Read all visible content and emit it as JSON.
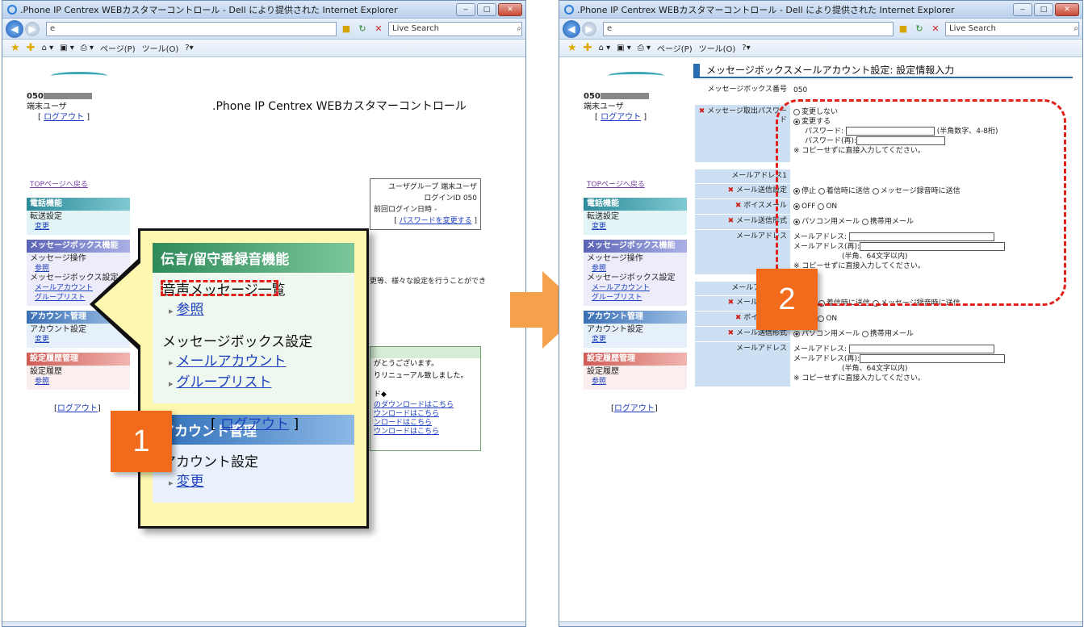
{
  "window_title": ".Phone IP Centrex WEBカスタマーコントロール - Dell により提供された Internet Explorer",
  "address_value": "e",
  "search_placeholder": "Live Search",
  "toolbar": {
    "page": "ページ(P)",
    "tools": "ツール(O)"
  },
  "left": {
    "user_id": "050",
    "user_role": "端末ユーザ",
    "logout": "ログアウト",
    "page_title": ".Phone IP Centrex WEBカスタマーコントロール",
    "top_back": "TOPページへ戻る",
    "info": {
      "group_label": "ユーザグループ",
      "group_value": "端末ユーザ",
      "login_id_label": "ログインID",
      "login_id_value": "050",
      "last_login_label": "前回ログイン日時",
      "last_login_value": "-",
      "change_password": "パスワードを変更する"
    },
    "sidebar": [
      {
        "header": "電話機能",
        "items": [
          {
            "label": "転送設定",
            "sub": "変更"
          }
        ]
      },
      {
        "header": "メッセージボックス機能",
        "items": [
          {
            "label": "メッセージ操作",
            "sub": "参照"
          },
          {
            "label": "メッセージボックス設定",
            "sub": "メールアカウント"
          },
          {
            "label": "",
            "sub": "グループリスト"
          }
        ]
      },
      {
        "header": "アカウント管理",
        "items": [
          {
            "label": "アカウント設定",
            "sub": "変更"
          }
        ]
      },
      {
        "header": "設定履歴管理",
        "items": [
          {
            "label": "設定履歴",
            "sub": "参照"
          }
        ]
      }
    ],
    "frag_settings": "更等、様々な設定を行うことができ",
    "green_text1": "がとうございます。",
    "green_text2": "りリニューアル致しました。",
    "green_mark": "ド◆",
    "green_links": [
      "のダウンロードはこちら",
      "ウンロードはこちら",
      "ンロードはこちら",
      "ウンロードはこちら"
    ],
    "zoom": {
      "section1": "伝言/留守番録音機能",
      "voice_list": "音声メッセージ一覧",
      "ref": "参照",
      "mbox_settings": "メッセージボックス設定",
      "mail_account": "メールアカウント",
      "group_list": "グループリスト",
      "section2": "アカウント管理",
      "account_settings": "アカウント設定",
      "change": "変更",
      "logout": "ログアウト"
    },
    "badge": "1"
  },
  "right": {
    "title": "メッセージボックスメールアカウント設定: 設定情報入力",
    "mbox_number_label": "メッセージボックス番号",
    "mbox_number_value": "050",
    "pw_label": "メッセージ取出パスワード",
    "pw_no_change": "変更しない",
    "pw_change": "変更する",
    "pw_field": "パスワード:",
    "pw_hint": "(半角数字、4-8桁)",
    "pw_again": "パスワード(再):",
    "paste_note": "※ コピーせずに直接入力してください。",
    "mail1_header": "メールアドレス1",
    "mail2_header": "メールアドレス2",
    "send_setting_label": "メール送信設定",
    "send_stop": "停止",
    "send_on_arrival": "着信時に送信",
    "send_on_record": "メッセージ録音時に送信",
    "voicemail_label": "ボイスメール",
    "off": "OFF",
    "on": "ON",
    "format_label": "メール送信形式",
    "format_pc": "パソコン用メール",
    "format_mobile": "携帯用メール",
    "address_label": "メールアドレス",
    "address_field": "メールアドレス:",
    "address_again": "メールアドレス(再):",
    "address_hint": "(半角、64文字以内)",
    "logout": "ログアウト",
    "badge": "2"
  }
}
